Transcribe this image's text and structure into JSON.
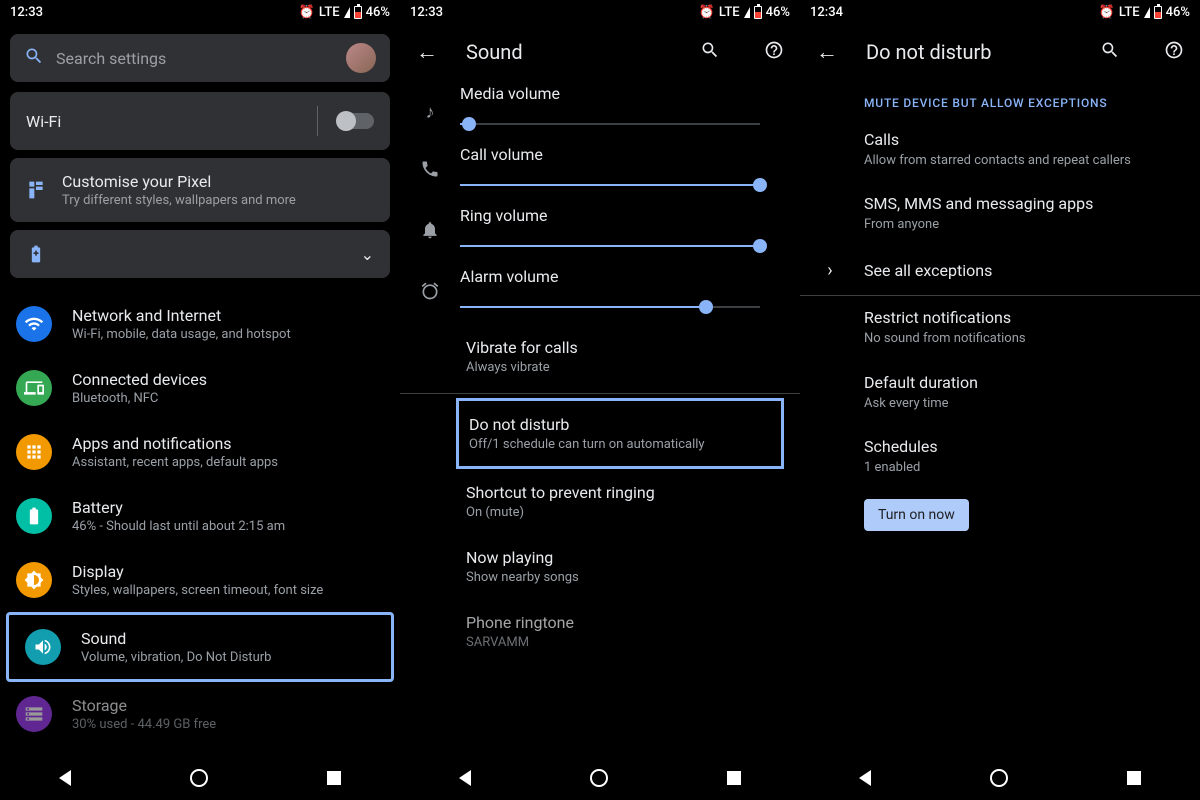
{
  "status": {
    "time1": "12:33",
    "time2": "12:33",
    "time3": "12:34",
    "net": "LTE",
    "battery": "46%"
  },
  "s1": {
    "search_ph": "Search settings",
    "wifi": "Wi-Fi",
    "customise": {
      "t": "Customise your Pixel",
      "s": "Try different styles, wallpapers and more"
    },
    "rows": [
      {
        "t": "Network and Internet",
        "s": "Wi-Fi, mobile, data usage, and hotspot"
      },
      {
        "t": "Connected devices",
        "s": "Bluetooth, NFC"
      },
      {
        "t": "Apps and notifications",
        "s": "Assistant, recent apps, default apps"
      },
      {
        "t": "Battery",
        "s": "46% - Should last until about 2:15 am"
      },
      {
        "t": "Display",
        "s": "Styles, wallpapers, screen timeout, font size"
      },
      {
        "t": "Sound",
        "s": "Volume, vibration, Do Not Disturb"
      },
      {
        "t": "Storage",
        "s": "30% used - 44.49 GB free"
      }
    ]
  },
  "s2": {
    "title": "Sound",
    "vols": [
      {
        "l": "Media volume",
        "v": 3
      },
      {
        "l": "Call volume",
        "v": 100
      },
      {
        "l": "Ring volume",
        "v": 100
      },
      {
        "l": "Alarm volume",
        "v": 82
      }
    ],
    "vibrate": {
      "t": "Vibrate for calls",
      "s": "Always vibrate"
    },
    "dnd": {
      "t": "Do not disturb",
      "s": "Off/1 schedule can turn on automatically"
    },
    "shortcut": {
      "t": "Shortcut to prevent ringing",
      "s": "On (mute)"
    },
    "now": {
      "t": "Now playing",
      "s": "Show nearby songs"
    },
    "ringtone": {
      "t": "Phone ringtone",
      "s": "SARVAMM"
    }
  },
  "s3": {
    "title": "Do not disturb",
    "section": "MUTE DEVICE BUT ALLOW EXCEPTIONS",
    "calls": {
      "t": "Calls",
      "s": "Allow from starred contacts and repeat callers"
    },
    "sms": {
      "t": "SMS, MMS and messaging apps",
      "s": "From anyone"
    },
    "see_all": "See all exceptions",
    "restrict": {
      "t": "Restrict notifications",
      "s": "No sound from notifications"
    },
    "duration": {
      "t": "Default duration",
      "s": "Ask every time"
    },
    "schedules": {
      "t": "Schedules",
      "s": "1 enabled"
    },
    "turn_on": "Turn on now"
  }
}
